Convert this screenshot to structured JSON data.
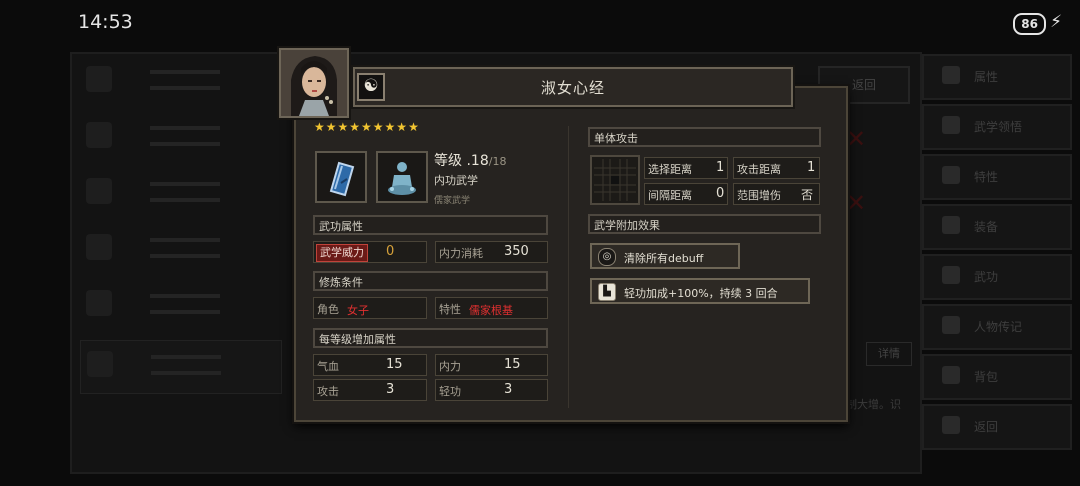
{
  "status_bar": {
    "time": "14:53",
    "battery": "86"
  },
  "background": {
    "right_box_label": "返回",
    "detail_label": "详情",
    "sidebar": [
      {
        "label": "属性",
        "icon": "person-icon"
      },
      {
        "label": "武学领悟",
        "icon": "meditate-icon"
      },
      {
        "label": "特性",
        "icon": "person-icon"
      },
      {
        "label": "装备",
        "icon": "sword-icon"
      },
      {
        "label": "武功",
        "icon": "scroll-icon"
      },
      {
        "label": "人物传记",
        "icon": "book-icon"
      },
      {
        "label": "背包",
        "icon": "bag-icon"
      },
      {
        "label": "返回",
        "icon": "door-icon"
      }
    ],
    "text_snippet": "制大增。识"
  },
  "dialog": {
    "title": "淑女心经",
    "stars": "★★★★★★★★★",
    "level_label": "等级 .",
    "level": "18",
    "level_max": "/18",
    "type": "内功武学",
    "school": "儒家武学",
    "sections": {
      "martial_attrs": "武功属性",
      "requirements": "修炼条件",
      "per_level": "每等级增加属性",
      "single_attack": "单体攻击",
      "extra_effects": "武学附加效果"
    },
    "martial": {
      "power_label": "武学威力",
      "power_value": "0",
      "cost_label": "内力消耗",
      "cost_value": "350"
    },
    "requirements": {
      "role_label": "角色",
      "role_value": "女子",
      "trait_label": "特性",
      "trait_value": "儒家根基"
    },
    "per_level": [
      {
        "label": "气血",
        "value": "15"
      },
      {
        "label": "内力",
        "value": "15"
      },
      {
        "label": "攻击",
        "value": "3"
      },
      {
        "label": "轻功",
        "value": "3"
      }
    ],
    "attack": [
      {
        "label": "选择距离",
        "value": "1"
      },
      {
        "label": "攻击距离",
        "value": "1"
      },
      {
        "label": "间隔距离",
        "value": "0"
      },
      {
        "label": "范围增伤",
        "value": "否"
      }
    ],
    "effects": [
      {
        "text": "清除所有debuff",
        "icon": "target-icon"
      },
      {
        "text": "轻功加成+100%，持续 3 回合",
        "icon": "boot-icon"
      }
    ]
  }
}
